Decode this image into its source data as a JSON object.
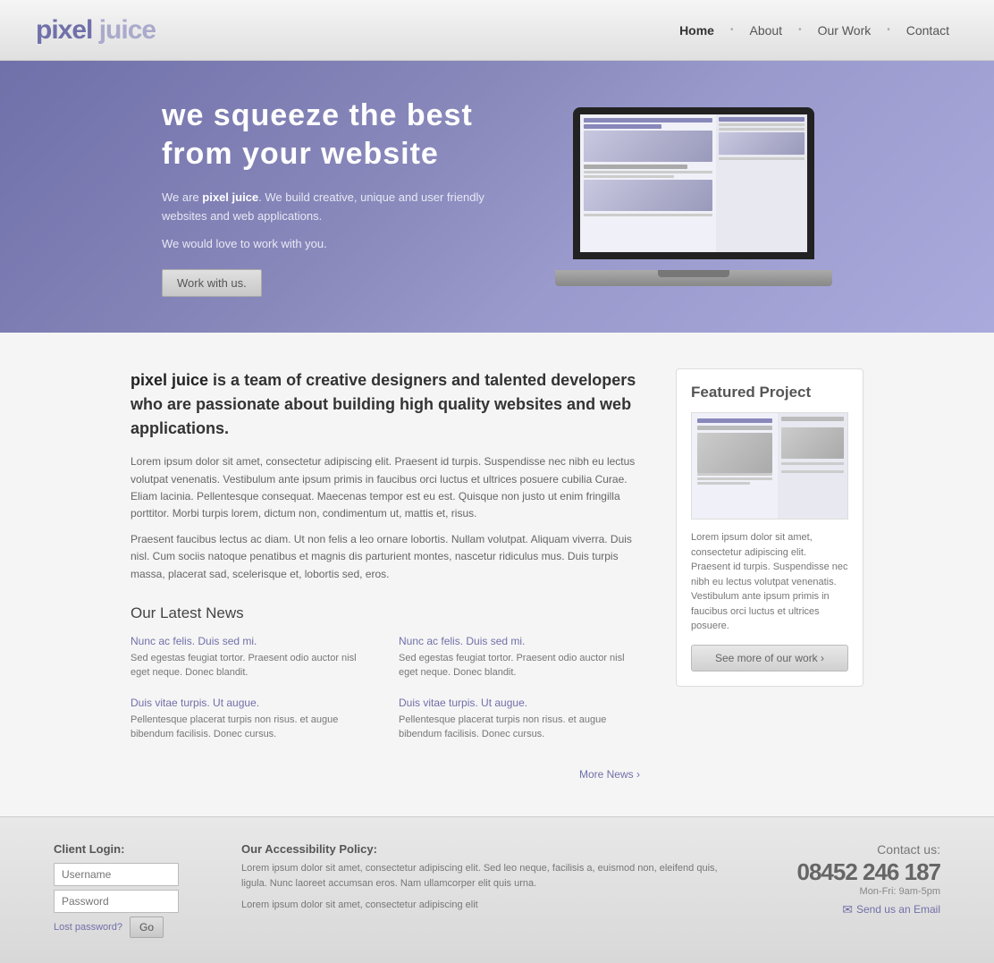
{
  "header": {
    "logo": "pixel juice",
    "nav": {
      "home": "Home",
      "about": "About",
      "our_work": "Our Work",
      "contact": "Contact"
    }
  },
  "hero": {
    "headline_line1": "we squeeze the best",
    "headline_line2": "from your website",
    "intro": "We are ",
    "brand": "pixel juice",
    "intro_rest": ". We build creative, unique and user friendly websites and web applications.",
    "tagline": "We would love to work with you.",
    "cta_label": "Work with us."
  },
  "about": {
    "brand": "pixel juice",
    "description": " is a team of creative designers and talented developers who are passionate about building high quality websites and web applications.",
    "para1": "Lorem ipsum dolor sit amet, consectetur adipiscing elit. Praesent id turpis. Suspendisse nec nibh eu lectus volutpat venenatis. Vestibulum ante ipsum primis in faucibus orci luctus et ultrices posuere cubilia Curae. Eliam lacinia. Pellentesque consequat. Maecenas tempor est eu est. Quisque non justo ut enim fringilla porttitor. Morbi turpis lorem, dictum non, condimentum ut, mattis et, risus.",
    "para2": "Praesent faucibus lectus ac diam. Ut non felis a leo ornare lobortis. Nullam volutpat. Aliquam viverra. Duis nisl. Cum sociis natoque penatibus et magnis dis parturient montes, nascetur ridiculus mus. Duis turpis massa, placerat sad, scelerisque et, lobortis sed, eros."
  },
  "latest_news": {
    "section_title": "Our Latest News",
    "items": [
      {
        "title": "Nunc ac felis. Duis sed mi.",
        "text": "Sed egestas feugiat tortor. Praesent odio auctor nisl eget neque. Donec blandit."
      },
      {
        "title": "Nunc ac felis. Duis sed mi.",
        "text": "Sed egestas feugiat tortor. Praesent odio auctor nisl eget neque. Donec blandit."
      },
      {
        "title": "Duis vitae turpis. Ut augue.",
        "text": "Pellentesque placerat turpis non risus. et augue bibendum facilisis. Donec cursus."
      },
      {
        "title": "Duis vitae turpis. Ut augue.",
        "text": "Pellentesque placerat turpis non risus. et augue bibendum facilisis. Donec cursus."
      }
    ],
    "more_label": "More News"
  },
  "featured_project": {
    "title": "Featured Project",
    "description": "Lorem ipsum dolor sit amet, consectetur adipiscing elit. Praesent id turpis. Suspendisse nec nibh eu lectus volutpat venenatis. Vestibulum ante ipsum primis in faucibus orci luctus et ultrices posuere.",
    "see_more_label": "See more of our work"
  },
  "footer": {
    "login": {
      "label": "Client Login:",
      "username_placeholder": "Username",
      "password_placeholder": "Password",
      "lost_pw_label": "Lost password?",
      "go_label": "Go"
    },
    "policy": {
      "title": "Our Accessibility Policy:",
      "para1": "Lorem ipsum dolor sit amet, consectetur adipiscing elit. Sed leo neque, facilisis a, euismod non, eleifend quis, ligula. Nunc laoreet accumsan eros. Nam ullamcorper elit quis urna.",
      "para2": "Lorem ipsum dolor sit amet, consectetur adipiscing elit"
    },
    "contact": {
      "label": "Contact us:",
      "phone": "08452 246 187",
      "hours": "Mon-Fri: 9am-5pm",
      "email_label": "Send us an Email"
    }
  },
  "colors": {
    "brand_purple": "#7070aa",
    "hero_bg": "#8888bb",
    "link_color": "#7070aa"
  }
}
